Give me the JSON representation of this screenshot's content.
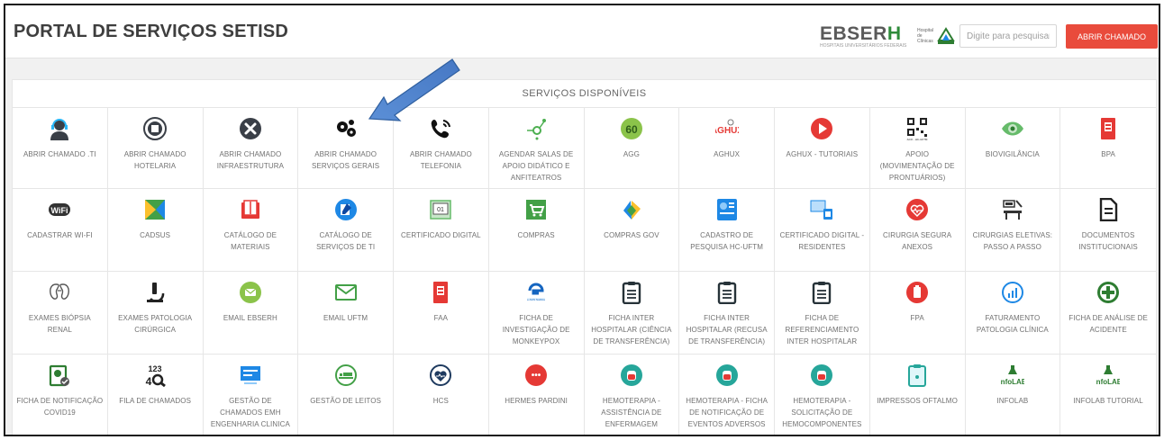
{
  "header": {
    "title": "PORTAL DE SERVIÇOS SETISD",
    "logo_text_main": "EBSER",
    "logo_text_h": "H",
    "logo_sub": "HOSPITAIS UNIVERSITÁRIOS FEDERAIS",
    "logo_small": "Hospital de Clínicas",
    "search_placeholder": "Digite para pesquisar",
    "button_label": "ABRIR CHAMADO"
  },
  "section_title": "SERVIÇOS DISPONÍVEIS",
  "services": [
    {
      "label": "ABRIR CHAMADO .TI",
      "icon": "headset-user-icon",
      "color": "#3a3f47"
    },
    {
      "label": "ABRIR CHAMADO HOTELARIA",
      "icon": "hotel-building-icon",
      "color": "#3a3f47"
    },
    {
      "label": "ABRIR CHAMADO INFRAESTRUTURA",
      "icon": "tools-icon",
      "color": "#3a3f47"
    },
    {
      "label": "ABRIR CHAMADO SERVIÇOS GERAIS",
      "icon": "gears-icon",
      "color": "#111111"
    },
    {
      "label": "ABRIR CHAMADO TELEFONIA",
      "icon": "phone-icon",
      "color": "#111111"
    },
    {
      "label": "AGENDAR SALAS DE APOIO DIDÁTICO E ANFITEATROS",
      "icon": "network-icon",
      "color": "#4caf50"
    },
    {
      "label": "AGG",
      "icon": "agg-icon",
      "color": "#8bc34a"
    },
    {
      "label": "AGHUX",
      "icon": "aghux-icon",
      "color": "#e53935"
    },
    {
      "label": "AGHUX - TUTORIAIS",
      "icon": "play-icon",
      "color": "#e53935"
    },
    {
      "label": "APOIO (MOVIMENTAÇÃO DE PRONTUÁRIOS)",
      "icon": "qr-code-icon",
      "color": "#222222"
    },
    {
      "label": "BIOVIGILÂNCIA",
      "icon": "eye-icon",
      "color": "#66bb6a"
    },
    {
      "label": "BPA",
      "icon": "document-red-icon",
      "color": "#e53935"
    },
    {
      "label": "CADASTRAR WI-FI",
      "icon": "wifi-icon",
      "color": "#333333"
    },
    {
      "label": "CADSUS",
      "icon": "cadsus-icon",
      "color": "#43a047"
    },
    {
      "label": "CATÁLOGO DE MATERIAIS",
      "icon": "book-icon",
      "color": "#e53935"
    },
    {
      "label": "CATÁLOGO DE SERVIÇOS DE TI",
      "icon": "edit-icon",
      "color": "#1e88e5"
    },
    {
      "label": "CERTIFICADO DIGITAL",
      "icon": "certificate-icon",
      "color": "#66bb6a"
    },
    {
      "label": "COMPRAS",
      "icon": "cart-icon",
      "color": "#43a047"
    },
    {
      "label": "COMPRAS GOV",
      "icon": "compras-gov-icon",
      "color": "#fbc02d"
    },
    {
      "label": "CADASTRO DE PESQUISA HC-UFTM",
      "icon": "research-icon",
      "color": "#1e88e5"
    },
    {
      "label": "CERTIFICADO DIGITAL - RESIDENTES",
      "icon": "certificate-residents-icon",
      "color": "#1e88e5"
    },
    {
      "label": "CIRURGIA SEGURA ANEXOS",
      "icon": "heart-pulse-icon",
      "color": "#e53935"
    },
    {
      "label": "CIRURGIAS ELETIVAS: PASSO A PASSO",
      "icon": "surgery-bed-icon",
      "color": "#333333"
    },
    {
      "label": "DOCUMENTOS INSTITUCIONAIS",
      "icon": "file-text-icon",
      "color": "#222222"
    },
    {
      "label": "EXAMES BIÓPSIA RENAL",
      "icon": "kidney-icon",
      "color": "#555555"
    },
    {
      "label": "EXAMES PATOLOGIA CIRÚRGICA",
      "icon": "microscope-icon",
      "color": "#222222"
    },
    {
      "label": "EMAIL EBSERH",
      "icon": "email-circle-icon",
      "color": "#8bc34a"
    },
    {
      "label": "EMAIL UFTM",
      "icon": "envelope-icon",
      "color": "#43a047"
    },
    {
      "label": "FAA",
      "icon": "document-red-icon",
      "color": "#e53935"
    },
    {
      "label": "FICHA DE INVESTIGAÇÃO DE MONKEYPOX",
      "icon": "monkeypox-icon",
      "color": "#1565c0"
    },
    {
      "label": "FICHA INTER HOSPITALAR (CIÊNCIA DE TRANSFERÊNCIA)",
      "icon": "clipboard-icon",
      "color": "#263238"
    },
    {
      "label": "FICHA INTER HOSPITALAR (RECUSA DE TRANSFERÊNCIA)",
      "icon": "clipboard-icon",
      "color": "#263238"
    },
    {
      "label": "FICHA DE REFERENCIAMENTO INTER HOSPITALAR",
      "icon": "clipboard-icon",
      "color": "#263238"
    },
    {
      "label": "FPA",
      "icon": "fpa-icon",
      "color": "#e53935"
    },
    {
      "label": "FATURAMENTO PATOLOGIA CLÍNICA",
      "icon": "chart-circle-icon",
      "color": "#1e88e5"
    },
    {
      "label": "FICHA DE ANÁLISE DE ACIDENTE",
      "icon": "plus-circle-icon",
      "color": "#2e7d32"
    },
    {
      "label": "FICHA DE NOTIFICAÇÃO COVID19",
      "icon": "covid-form-icon",
      "color": "#2e7d32"
    },
    {
      "label": "FILA DE CHAMADOS",
      "icon": "number-search-icon",
      "color": "#222222"
    },
    {
      "label": "GESTÃO DE CHAMADOS EMH ENGENHARIA CLINICA",
      "icon": "dashboard-icon",
      "color": "#1e88e5"
    },
    {
      "label": "GESTÃO DE LEITOS",
      "icon": "bed-circle-icon",
      "color": "#43a047"
    },
    {
      "label": "HCS",
      "icon": "heart-circle-icon",
      "color": "#1e3a5f"
    },
    {
      "label": "HERMES PARDINI",
      "icon": "hermes-pardini-icon",
      "color": "#e53935"
    },
    {
      "label": "HEMOTERAPIA - ASSISTÊNCIA DE ENFERMAGEM",
      "icon": "blood-bag-icon",
      "color": "#26a69a"
    },
    {
      "label": "HEMOTERAPIA - FICHA DE NOTIFICAÇÃO DE EVENTOS ADVERSOS",
      "icon": "blood-bag-icon",
      "color": "#26a69a"
    },
    {
      "label": "HEMOTERAPIA - SOLICITAÇÃO DE HEMOCOMPONENTES",
      "icon": "blood-bag-icon",
      "color": "#26a69a"
    },
    {
      "label": "IMPRESSOS OFTALMO",
      "icon": "clipboard-teal-icon",
      "color": "#26a69a"
    },
    {
      "label": "INFOLAB",
      "icon": "infolab-icon",
      "color": "#2e7d32"
    },
    {
      "label": "INFOLAB TUTORIAL",
      "icon": "infolab-icon",
      "color": "#2e7d32"
    }
  ],
  "infolab_text": "InfoLAB",
  "qr_caption": "ACO - HC-UFTM",
  "agg_text": "60",
  "aghux_text": "AGHUX",
  "monkeypox_caption": "e-SUS Notifica",
  "number_search_text": "123",
  "hermes_dots": "•••"
}
